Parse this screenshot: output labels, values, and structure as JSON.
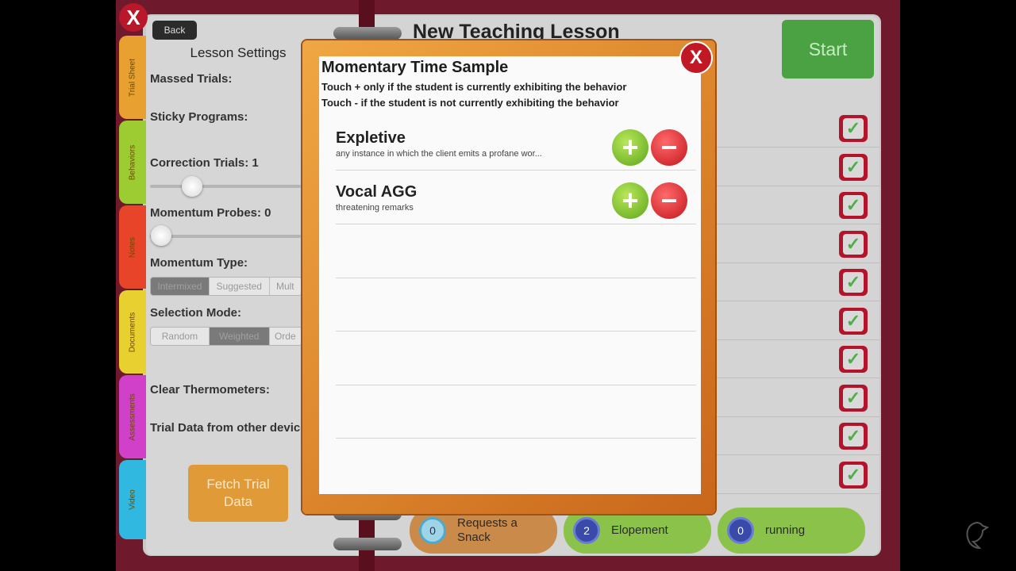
{
  "app": {
    "close_label": "X",
    "back_label": "Back",
    "lesson_title": "New Teaching Lesson",
    "start_label": "Start"
  },
  "tabs": [
    {
      "label": "Trial Sheet",
      "color": "#e8a030"
    },
    {
      "label": "Behaviors",
      "color": "#9ccc32"
    },
    {
      "label": "Notes",
      "color": "#e8442a"
    },
    {
      "label": "Documents",
      "color": "#e8d030"
    },
    {
      "label": "Assessments",
      "color": "#d040c8"
    },
    {
      "label": "Video",
      "color": "#30b8e0"
    }
  ],
  "settings": {
    "title": "Lesson Settings",
    "massed_trials": "Massed Trials:",
    "sticky_programs": "Sticky Programs:",
    "correction_trials": "Correction Trials: 1",
    "correction_value": 1,
    "momentum_probes": "Momentum Probes: 0",
    "momentum_value": 0,
    "momentum_type": "Momentum Type:",
    "momentum_options": [
      "Intermixed",
      "Suggested",
      "Mult"
    ],
    "momentum_selected": "Intermixed",
    "selection_mode": "Selection Mode:",
    "selection_options": [
      "Random",
      "Weighted",
      "Orde"
    ],
    "selection_selected": "Weighted",
    "clear_thermometers": "Clear Thermometers:",
    "trial_data_other": "Trial Data from other device",
    "fetch_label": "Fetch Trial Data"
  },
  "checkmark_count": 10,
  "bottom_behaviors": [
    {
      "count": "0",
      "label": "Requests a Snack",
      "color": "#c98a4a"
    },
    {
      "count": "2",
      "label": "Elopement",
      "color": "#8bc34a"
    },
    {
      "count": "0",
      "label": "running",
      "color": "#8bc34a"
    }
  ],
  "modal": {
    "title": "Momentary Time Sample",
    "instruction1": "Touch + only if the student is currently exhibiting the behavior",
    "instruction2": "Touch - if the student is not currently exhibiting the behavior",
    "close_label": "X",
    "behaviors": [
      {
        "name": "Expletive",
        "description": "any instance in which the client emits a profane wor..."
      },
      {
        "name": "Vocal AGG",
        "description": "threatening remarks"
      }
    ]
  }
}
